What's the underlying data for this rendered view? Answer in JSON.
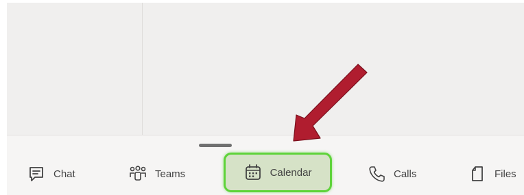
{
  "tabbar": {
    "tabs": [
      {
        "label": "Chat",
        "icon": "chat-icon"
      },
      {
        "label": "Teams",
        "icon": "teams-icon"
      },
      {
        "label": "Calendar",
        "icon": "calendar-icon",
        "selected": true
      },
      {
        "label": "Calls",
        "icon": "phone-icon"
      },
      {
        "label": "Files",
        "icon": "file-icon"
      }
    ]
  },
  "annotation": {
    "arrow_color": "#b01d2f",
    "highlight_color": "#5fd33a"
  }
}
